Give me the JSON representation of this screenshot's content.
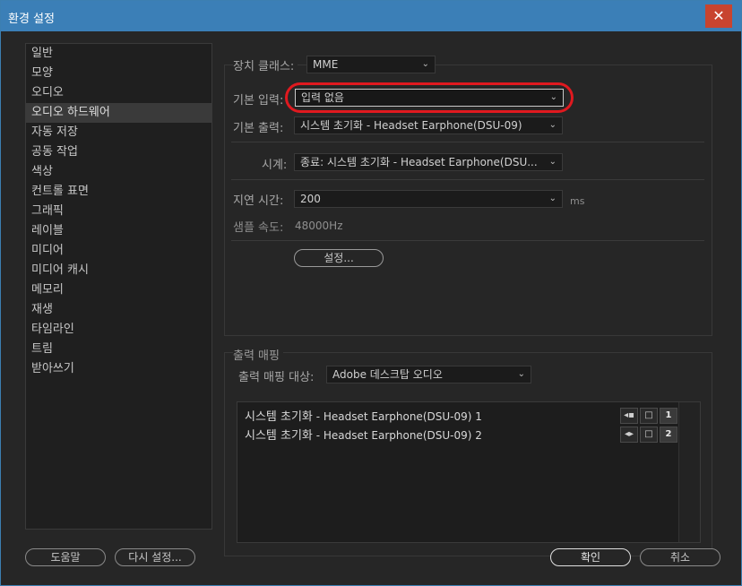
{
  "window": {
    "title": "환경 설정",
    "close_symbol": "✕"
  },
  "sidebar": {
    "items": [
      {
        "label": "일반"
      },
      {
        "label": "모양"
      },
      {
        "label": "오디오"
      },
      {
        "label": "오디오 하드웨어",
        "selected": true
      },
      {
        "label": "자동 저장"
      },
      {
        "label": "공동 작업"
      },
      {
        "label": "색상"
      },
      {
        "label": "컨트롤 표면"
      },
      {
        "label": "그래픽"
      },
      {
        "label": "레이블"
      },
      {
        "label": "미디어"
      },
      {
        "label": "미디어 캐시"
      },
      {
        "label": "메모리"
      },
      {
        "label": "재생"
      },
      {
        "label": "타임라인"
      },
      {
        "label": "트림"
      },
      {
        "label": "받아쓰기"
      }
    ]
  },
  "audio_hardware": {
    "device_class_label": "장치 클래스:",
    "device_class_value": "MME",
    "default_input_label": "기본 입력:",
    "default_input_value": "입력 없음",
    "default_output_label": "기본 출력:",
    "default_output_value": "시스템 초기화 - Headset Earphone(DSU-09)",
    "master_clock_label": "시계:",
    "master_clock_value": "종료: 시스템 초기화 - Headset Earphone(DSU...",
    "latency_label": "지연 시간:",
    "latency_value": "200",
    "latency_unit": "ms",
    "sample_rate_label": "샘플 속도:",
    "sample_rate_value": "48000Hz",
    "settings_button": "설정..."
  },
  "output_mapping": {
    "section_title": "출력 매핑",
    "target_label": "출력 매핑 대상:",
    "target_value": "Adobe 데스크탑 오디오",
    "rows": [
      {
        "prefix": "시스템 초기화",
        "suffix": " - Headset Earphone(DSU-09) 1",
        "channel": "1"
      },
      {
        "prefix": "시스템 초기화",
        "suffix": " - Headset Earphone(DSU-09) 2",
        "channel": "2"
      }
    ]
  },
  "footer": {
    "help_button": "도움말",
    "reset_button": "다시 설정...",
    "ok_button": "확인",
    "cancel_button": "취소"
  },
  "colors": {
    "titlebar": "#3b7fb7",
    "close_button": "#c8442f",
    "highlight_ellipse": "#e0191f"
  }
}
